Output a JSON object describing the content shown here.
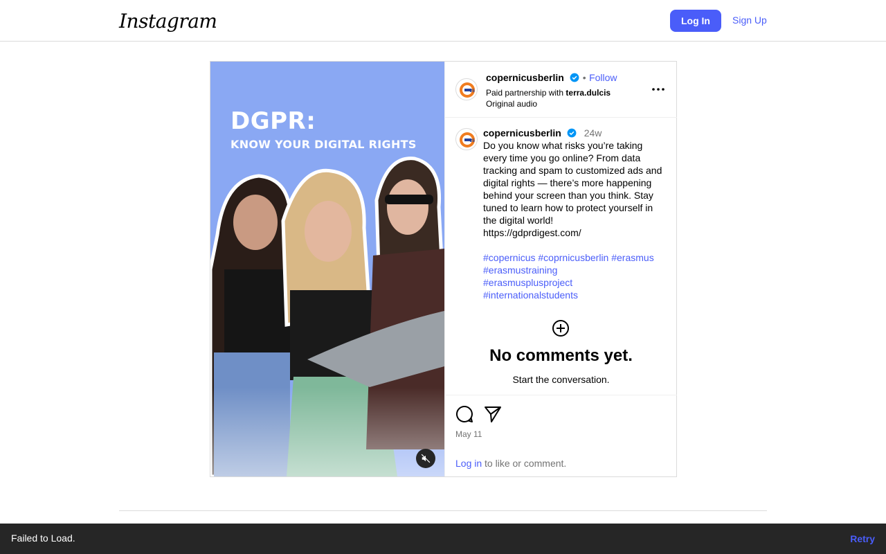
{
  "header": {
    "logo_text": "Instagram",
    "login_label": "Log In",
    "signup_label": "Sign Up"
  },
  "media": {
    "title": "DGPR:",
    "subtitle": "KNOW YOUR DIGITAL RIGHTS",
    "background_color": "#8aa8f3",
    "mute_icon": "volume-muted-icon"
  },
  "post_header": {
    "username": "copernicusberlin",
    "separator": "•",
    "follow_label": "Follow",
    "partnership_prefix": "Paid partnership with",
    "partner": "terra.dulcis",
    "audio": "Original audio",
    "more_icon": "more-options-icon"
  },
  "caption": {
    "username": "copernicusberlin",
    "age": "24w",
    "text": "Do you know what risks you’re taking every time you go online? From data tracking and spam to customized ads and digital rights — there’s more happening behind your screen than you think. Stay tuned to learn how to protect yourself in the digital world!\nhttps://gdprdigest.com/",
    "hashtags": [
      "#copernicus",
      "#coprnicusberlin",
      "#erasmus",
      "#erasmustraining",
      "#erasmusplusproject",
      "#internationalstudents"
    ]
  },
  "comments": {
    "empty_title": "No comments yet.",
    "empty_sub": "Start the conversation."
  },
  "actions": {
    "comment_icon": "comment-icon",
    "share_icon": "share-icon",
    "date": "May 11",
    "login_link": "Log in",
    "login_suffix": " to like or comment."
  },
  "toast": {
    "message": "Failed to Load.",
    "retry_label": "Retry"
  },
  "colors": {
    "accent": "#4a5df9",
    "verified": "#0095f6",
    "toast_bg": "#262626"
  }
}
